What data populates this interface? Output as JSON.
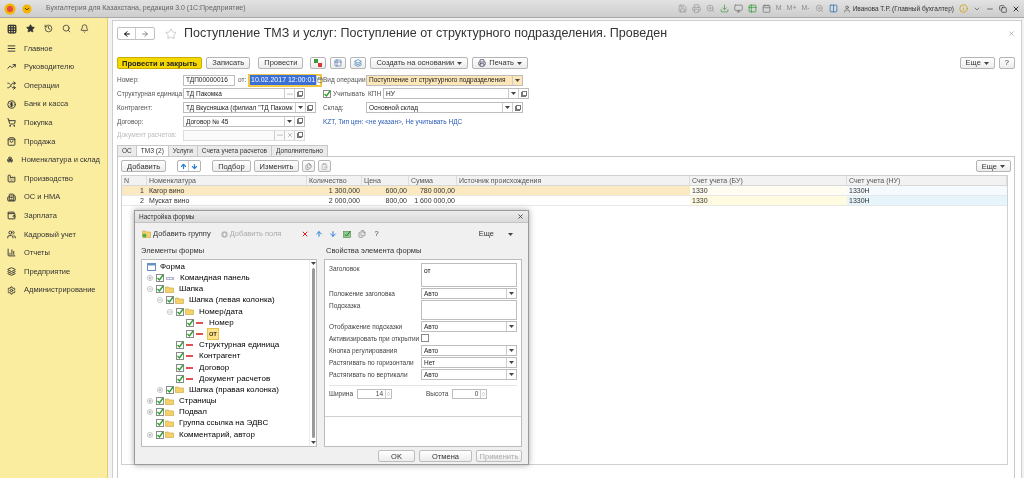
{
  "window": {
    "title": "Бухгалтерия для Казахстана, редакция 3.0  (1С:Предприятие)",
    "memory_buttons": [
      "M",
      "M+",
      "M-"
    ],
    "user": "Иванова Т.Р. (Главный бухгалтер)"
  },
  "sidebar": {
    "items": [
      "Главное",
      "Руководителю",
      "Операции",
      "Банк и касса",
      "Покупка",
      "Продажа",
      "Номенклатура и склад",
      "Производство",
      "ОС и НМА",
      "Зарплата",
      "Кадровый учет",
      "Отчеты",
      "Предприятие",
      "Администрирование"
    ]
  },
  "document": {
    "title": "Поступление ТМЗ и услуг: Поступление от структурного подразделения. Проведен",
    "toolbar": {
      "primary": "Провести и закрыть",
      "buttons": [
        "Записать",
        "Провести"
      ],
      "create_based": "Создать на основании",
      "print": "Печать",
      "more": "Еще",
      "help": "?"
    },
    "number": {
      "label": "Номер:",
      "value": "ТДП00000016"
    },
    "date": {
      "label": "от:",
      "value": "10.02.2017 12:00:01",
      "focused": true
    },
    "left_fields": [
      {
        "label": "Структурная единица:",
        "value": "ТД Пакомка",
        "kind": "choice",
        "disabled": false
      },
      {
        "label": "Контрагент:",
        "value": "ТД Вкусняшка (филиал \"ТД Пакомк",
        "kind": "select",
        "disabled": false
      },
      {
        "label": "Договор:",
        "value": "Договор № 45",
        "kind": "select",
        "disabled": false
      },
      {
        "label": "Документ расчетов:",
        "kind": "choice_clear",
        "disabled": true
      }
    ],
    "operation": {
      "label": "Вид операции:",
      "value": "Поступление от структурного подразделения",
      "highlighted": true
    },
    "kpn": {
      "label": "Учитывать",
      "checked": true,
      "field_label": "КПН",
      "value": "НУ"
    },
    "warehouse": {
      "label": "Склад:",
      "value": "Основной склад"
    },
    "prices_link": "KZT, Тип цен: <не указан>, Не учитывать НДС",
    "tabs": [
      {
        "label": "ОС",
        "selected": false
      },
      {
        "label": "ТМЗ (2)",
        "selected": true
      },
      {
        "label": "Услуги",
        "selected": false
      },
      {
        "label": "Счета учета расчетов",
        "selected": false
      },
      {
        "label": "Дополнительно",
        "selected": false
      }
    ],
    "table_toolbar": {
      "add": "Добавить",
      "pick": "Подбор",
      "edit": "Изменить",
      "more": "Еще"
    },
    "table": {
      "columns": [
        "N",
        "Номенклатура",
        "Количество",
        "Цена",
        "Сумма",
        "Источник происхождения",
        "Счет учета (БУ)",
        "Счет учета (НУ)"
      ],
      "rows": [
        {
          "selected": true,
          "cells": [
            "1",
            "Кагор вино",
            "1 300,000",
            "600,00",
            "780 000,00",
            "",
            "1330",
            "1330Н"
          ]
        },
        {
          "selected": false,
          "cells": [
            "2",
            "Мускат вино",
            "2 000,000",
            "800,00",
            "1 600 000,00",
            "",
            "1330",
            "1330Н"
          ]
        }
      ]
    }
  },
  "dialog": {
    "title": "Настройка формы",
    "toolbar": {
      "add_group": {
        "label": "Добавить группу",
        "disabled": false
      },
      "add_fields": {
        "label": "Добавить поля",
        "disabled": true
      },
      "help": "?",
      "more": "Еще"
    },
    "left_title": "Элементы формы",
    "right_title": "Свойства элемента формы",
    "tree": {
      "label": "Форма",
      "children": [
        {
          "label": "Командная панель",
          "kind": "panel",
          "checked": true,
          "expanded": false,
          "selected": false
        },
        {
          "label": "Шапка",
          "kind": "folder",
          "checked": true,
          "expanded": true,
          "selected": false,
          "children": [
            {
              "label": "Шапка (левая колонка)",
              "kind": "folder",
              "checked": true,
              "expanded": true,
              "selected": false,
              "children": [
                {
                  "label": "Номер/дата",
                  "kind": "folder",
                  "checked": true,
                  "expanded": true,
                  "selected": false,
                  "children": [
                    {
                      "label": "Номер",
                      "kind": "field",
                      "checked": true,
                      "selected": false
                    },
                    {
                      "label": "от",
                      "kind": "field",
                      "checked": true,
                      "selected": true
                    }
                  ]
                },
                {
                  "label": "Структурная единица",
                  "kind": "field",
                  "checked": true,
                  "selected": false
                },
                {
                  "label": "Контрагент",
                  "kind": "field",
                  "checked": true,
                  "selected": false
                },
                {
                  "label": "Договор",
                  "kind": "field",
                  "checked": true,
                  "selected": false
                },
                {
                  "label": "Документ расчетов",
                  "kind": "field",
                  "checked": true,
                  "selected": false
                }
              ]
            },
            {
              "label": "Шапка (правая колонка)",
              "kind": "folder",
              "checked": true,
              "expanded": false,
              "selected": false
            }
          ]
        },
        {
          "label": "Страницы",
          "kind": "folder",
          "checked": true,
          "expanded": false,
          "selected": false
        },
        {
          "label": "Подвал",
          "kind": "folder",
          "checked": true,
          "expanded": false,
          "selected": false
        },
        {
          "label": "Группа ссылка на ЭДВС",
          "kind": "folder",
          "checked": true,
          "selected": false
        },
        {
          "label": "Комментарий, автор",
          "kind": "folder",
          "checked": true,
          "expanded": false,
          "selected": false
        }
      ]
    },
    "properties": [
      {
        "kind": "textarea",
        "label": "Заголовок",
        "value": "от"
      },
      {
        "kind": "select",
        "label": "Положение заголовка",
        "value": "Авто"
      },
      {
        "kind": "textarea",
        "label": "Подсказка"
      },
      {
        "kind": "select",
        "label": "Отображение подсказки",
        "value": "Авто"
      },
      {
        "kind": "checkbox",
        "label": "Активизировать при открытии",
        "checked": false
      },
      {
        "kind": "select",
        "label": "Кнопка регулирования",
        "value": "Авто"
      },
      {
        "kind": "select",
        "label": "Растягивать по горизонтали",
        "value": "Нет"
      },
      {
        "kind": "select",
        "label": "Растягивать по вертикали",
        "value": "Авто"
      }
    ],
    "sizes": [
      {
        "label": "Ширина",
        "value": "14"
      },
      {
        "label": "Высота",
        "value": "0"
      }
    ],
    "buttons": [
      {
        "label": "OK",
        "disabled": false
      },
      {
        "label": "Отмена",
        "disabled": false
      },
      {
        "label": "Применить",
        "disabled": true
      }
    ]
  }
}
